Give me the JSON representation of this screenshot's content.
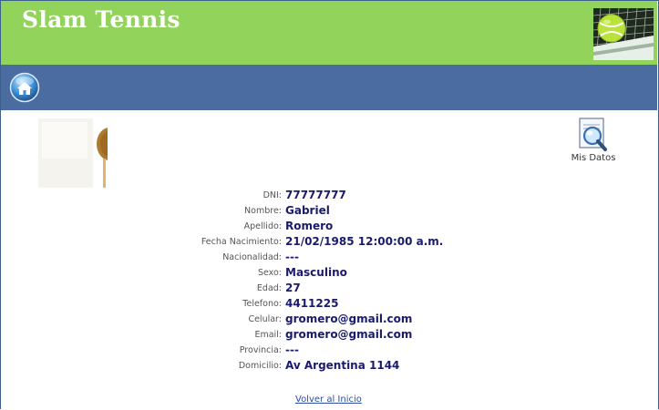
{
  "header": {
    "site_title": "Slam Tennis",
    "logo_icon": "tennis-ball-net-logo",
    "background_color": "#92d35b"
  },
  "navbar": {
    "background_color": "#4a6ca1",
    "home_icon": "home-button-icon"
  },
  "profile": {
    "photo_icon": "user-photo"
  },
  "mis_datos": {
    "label": "Mis Datos",
    "icon": "magnifier-document-icon"
  },
  "details": [
    {
      "key": "dni",
      "label": "DNI:",
      "value": "77777777"
    },
    {
      "key": "nombre",
      "label": "Nombre:",
      "value": "Gabriel"
    },
    {
      "key": "apellido",
      "label": "Apellido:",
      "value": "Romero"
    },
    {
      "key": "fecha-nacimiento",
      "label": "Fecha Nacimiento:",
      "value": "21/02/1985 12:00:00 a.m."
    },
    {
      "key": "nacionalidad",
      "label": "Nacionalidad:",
      "value": "---"
    },
    {
      "key": "sexo",
      "label": "Sexo:",
      "value": "Masculino"
    },
    {
      "key": "edad",
      "label": "Edad:",
      "value": "27"
    },
    {
      "key": "telefono",
      "label": "Telefono:",
      "value": "4411225"
    },
    {
      "key": "celular",
      "label": "Celular:",
      "value": "gromero@gmail.com"
    },
    {
      "key": "email",
      "label": "Email:",
      "value": "gromero@gmail.com"
    },
    {
      "key": "provincia",
      "label": "Provincia:",
      "value": "---"
    },
    {
      "key": "domicilio",
      "label": "Domicilio:",
      "value": "Av Argentina 1144"
    }
  ],
  "footer": {
    "back_link": "Volver al Inicio"
  }
}
